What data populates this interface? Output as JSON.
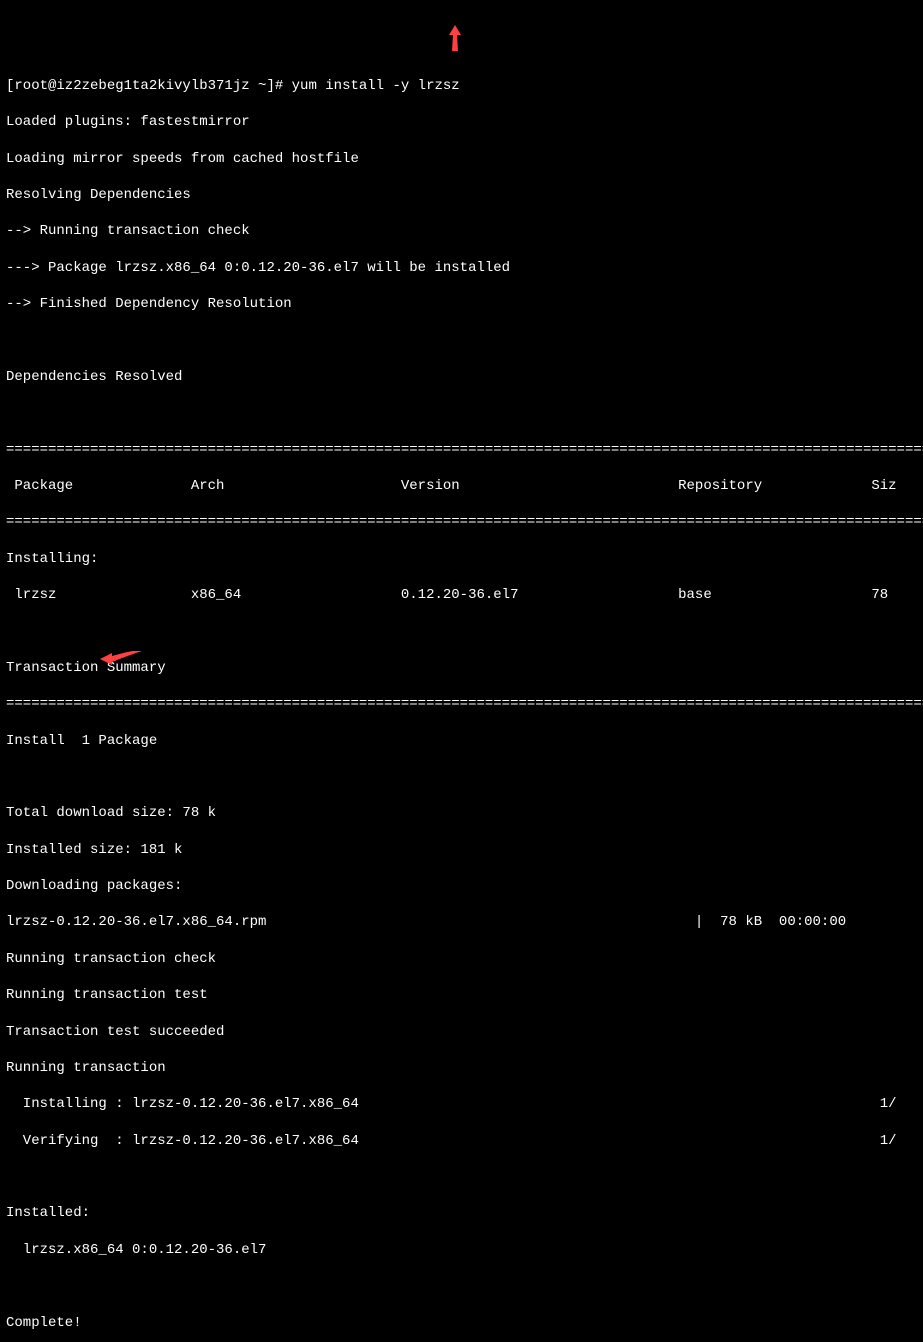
{
  "prompt": {
    "prefix": "[root@iz2zebeg1ta2kivylb371jz ~]# ",
    "command": "yum install -y lrzsz"
  },
  "loading": {
    "plugins": "Loaded plugins: fastestmirror",
    "mirror": "Loading mirror speeds from cached hostfile",
    "resolving": "Resolving Dependencies",
    "running_check": "--> Running transaction check",
    "package_installed": "---> Package lrzsz.x86_64 0:0.12.20-36.el7 will be installed",
    "finished": "--> Finished Dependency Resolution"
  },
  "deps_resolved": "Dependencies Resolved",
  "divider": "================================================================================================================",
  "table_header": " Package              Arch                     Version                          Repository             Siz",
  "installing_header": "Installing:",
  "table_row": " lrzsz                x86_64                   0.12.20-36.el7                   base                   78",
  "tx_summary": "Transaction Summary",
  "install_count": "Install  1 Package",
  "download_size": "Total download size: 78 k",
  "installed_size": "Installed size: 181 k",
  "downloading": "Downloading packages:",
  "rpm_line": "lrzsz-0.12.20-36.el7.x86_64.rpm                                                   |  78 kB  00:00:00",
  "running_tx_check": "Running transaction check",
  "running_tx_test": "Running transaction test",
  "tx_test_succeeded": "Transaction test succeeded",
  "running_tx": "Running transaction",
  "installing_line": "  Installing : lrzsz-0.12.20-36.el7.x86_64                                                              1/",
  "verifying_line": "  Verifying  : lrzsz-0.12.20-36.el7.x86_64                                                              1/",
  "installed_header": "Installed:",
  "installed_pkg": "  lrzsz.x86_64 0:0.12.20-36.el7",
  "complete": "Complete!",
  "annotations": {
    "arrow_color": "#ff4040"
  }
}
